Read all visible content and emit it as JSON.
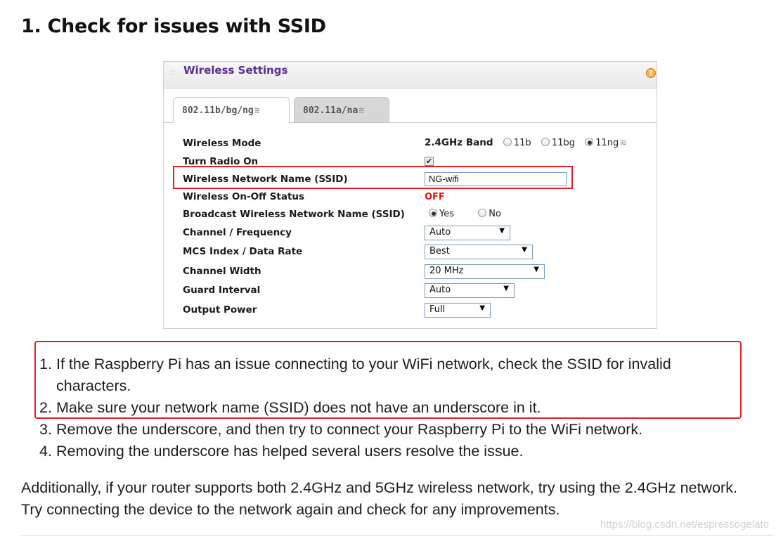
{
  "heading": "1. Check for issues with SSID",
  "router": {
    "panel_title": "Wireless Settings",
    "help_icon": "?",
    "grip_icon": "::",
    "tabs": [
      {
        "label": "802.11b/bg/ng",
        "active": true
      },
      {
        "label": "802.11a/na",
        "active": false
      }
    ],
    "wifi_glyph": "≋",
    "rows": {
      "wireless_mode": {
        "label": "Wireless Mode",
        "band": "2.4GHz Band",
        "options": [
          "11b",
          "11bg",
          "11ng"
        ],
        "selected": "11ng"
      },
      "turn_radio_on": {
        "label": "Turn Radio On",
        "checked": true,
        "check_glyph": "✔"
      },
      "ssid": {
        "label": "Wireless Network Name (SSID)",
        "value": "NG-wifi"
      },
      "on_off_status": {
        "label": "Wireless On-Off Status",
        "value": "OFF"
      },
      "broadcast": {
        "label": "Broadcast Wireless Network Name (SSID)",
        "options": [
          "Yes",
          "No"
        ],
        "selected": "Yes"
      },
      "channel": {
        "label": "Channel / Frequency",
        "value": "Auto"
      },
      "mcs": {
        "label": "MCS Index / Data Rate",
        "value": "Best"
      },
      "channel_width": {
        "label": "Channel Width",
        "value": "20 MHz"
      },
      "guard_interval": {
        "label": "Guard Interval",
        "value": "Auto"
      },
      "output_power": {
        "label": "Output Power",
        "value": "Full"
      }
    },
    "dropdown_arrow": "▼"
  },
  "steps": [
    {
      "num": "1.",
      "text": "If the Raspberry Pi has an issue connecting to your WiFi network, check the SSID for invalid characters."
    },
    {
      "num": "2.",
      "text": "Make sure your network name (SSID) does not have an underscore in it."
    },
    {
      "num": "3.",
      "text": "Remove the underscore, and then try to connect your Raspberry Pi to the WiFi network."
    },
    {
      "num": "4.",
      "text": "Removing the underscore has helped several users resolve the issue."
    }
  ],
  "paragraph": "Additionally, if your router supports both 2.4GHz and 5GHz wireless network, try using the 2.4GHz network. Try connecting the device to the network again and check for any improvements.",
  "watermark": "https://blog.csdn.net/espressogelato",
  "colors": {
    "highlight": "#e02028",
    "title_purple": "#5b2e91",
    "off_red": "#e8141a"
  }
}
